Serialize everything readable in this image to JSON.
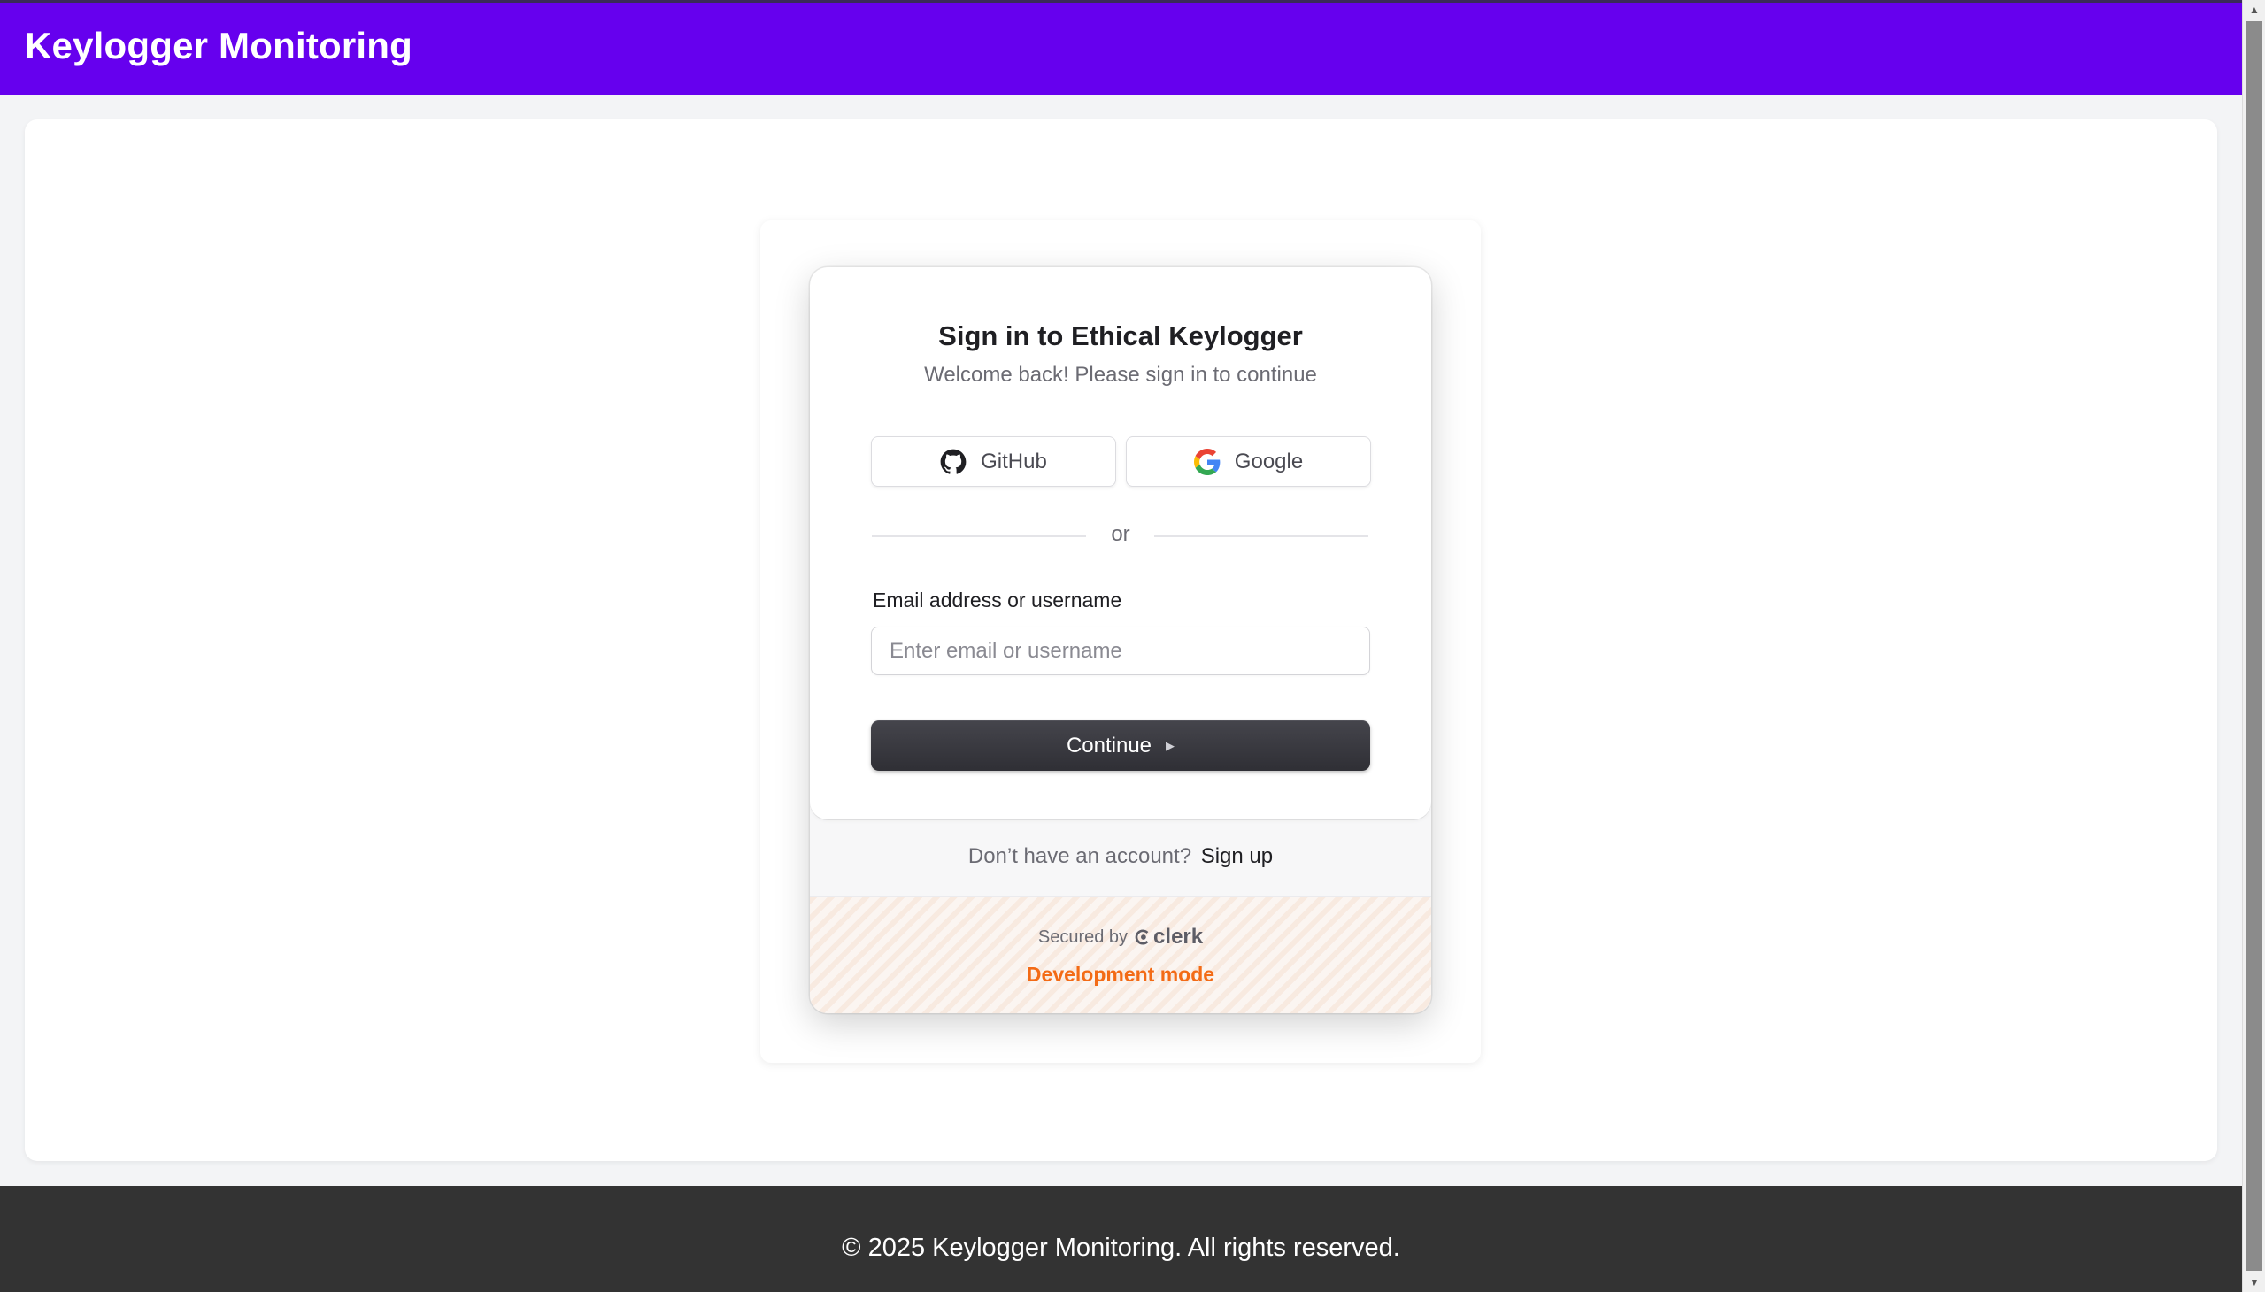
{
  "header": {
    "title": "Keylogger Monitoring"
  },
  "signin": {
    "title": "Sign in to Ethical Keylogger",
    "subtitle": "Welcome back! Please sign in to continue",
    "social": {
      "github_label": "GitHub",
      "github_icon": "github-icon",
      "google_label": "Google",
      "google_icon": "google-icon"
    },
    "divider": "or",
    "email": {
      "label": "Email address or username",
      "placeholder": "Enter email or username",
      "value": ""
    },
    "continue_label": "Continue",
    "continue_icon": "play-arrow-icon",
    "signup_prompt": "Don’t have an account?",
    "signup_link": "Sign up",
    "secured_by": "Secured by",
    "provider": "clerk",
    "dev_mode": "Development mode"
  },
  "footer": {
    "text": "© 2025 Keylogger Monitoring. All rights reserved."
  },
  "colors": {
    "header_bg": "#6600ee",
    "footer_bg": "#333333",
    "dev_mode": "#f36b16",
    "primary_button": "#2f2f35"
  }
}
